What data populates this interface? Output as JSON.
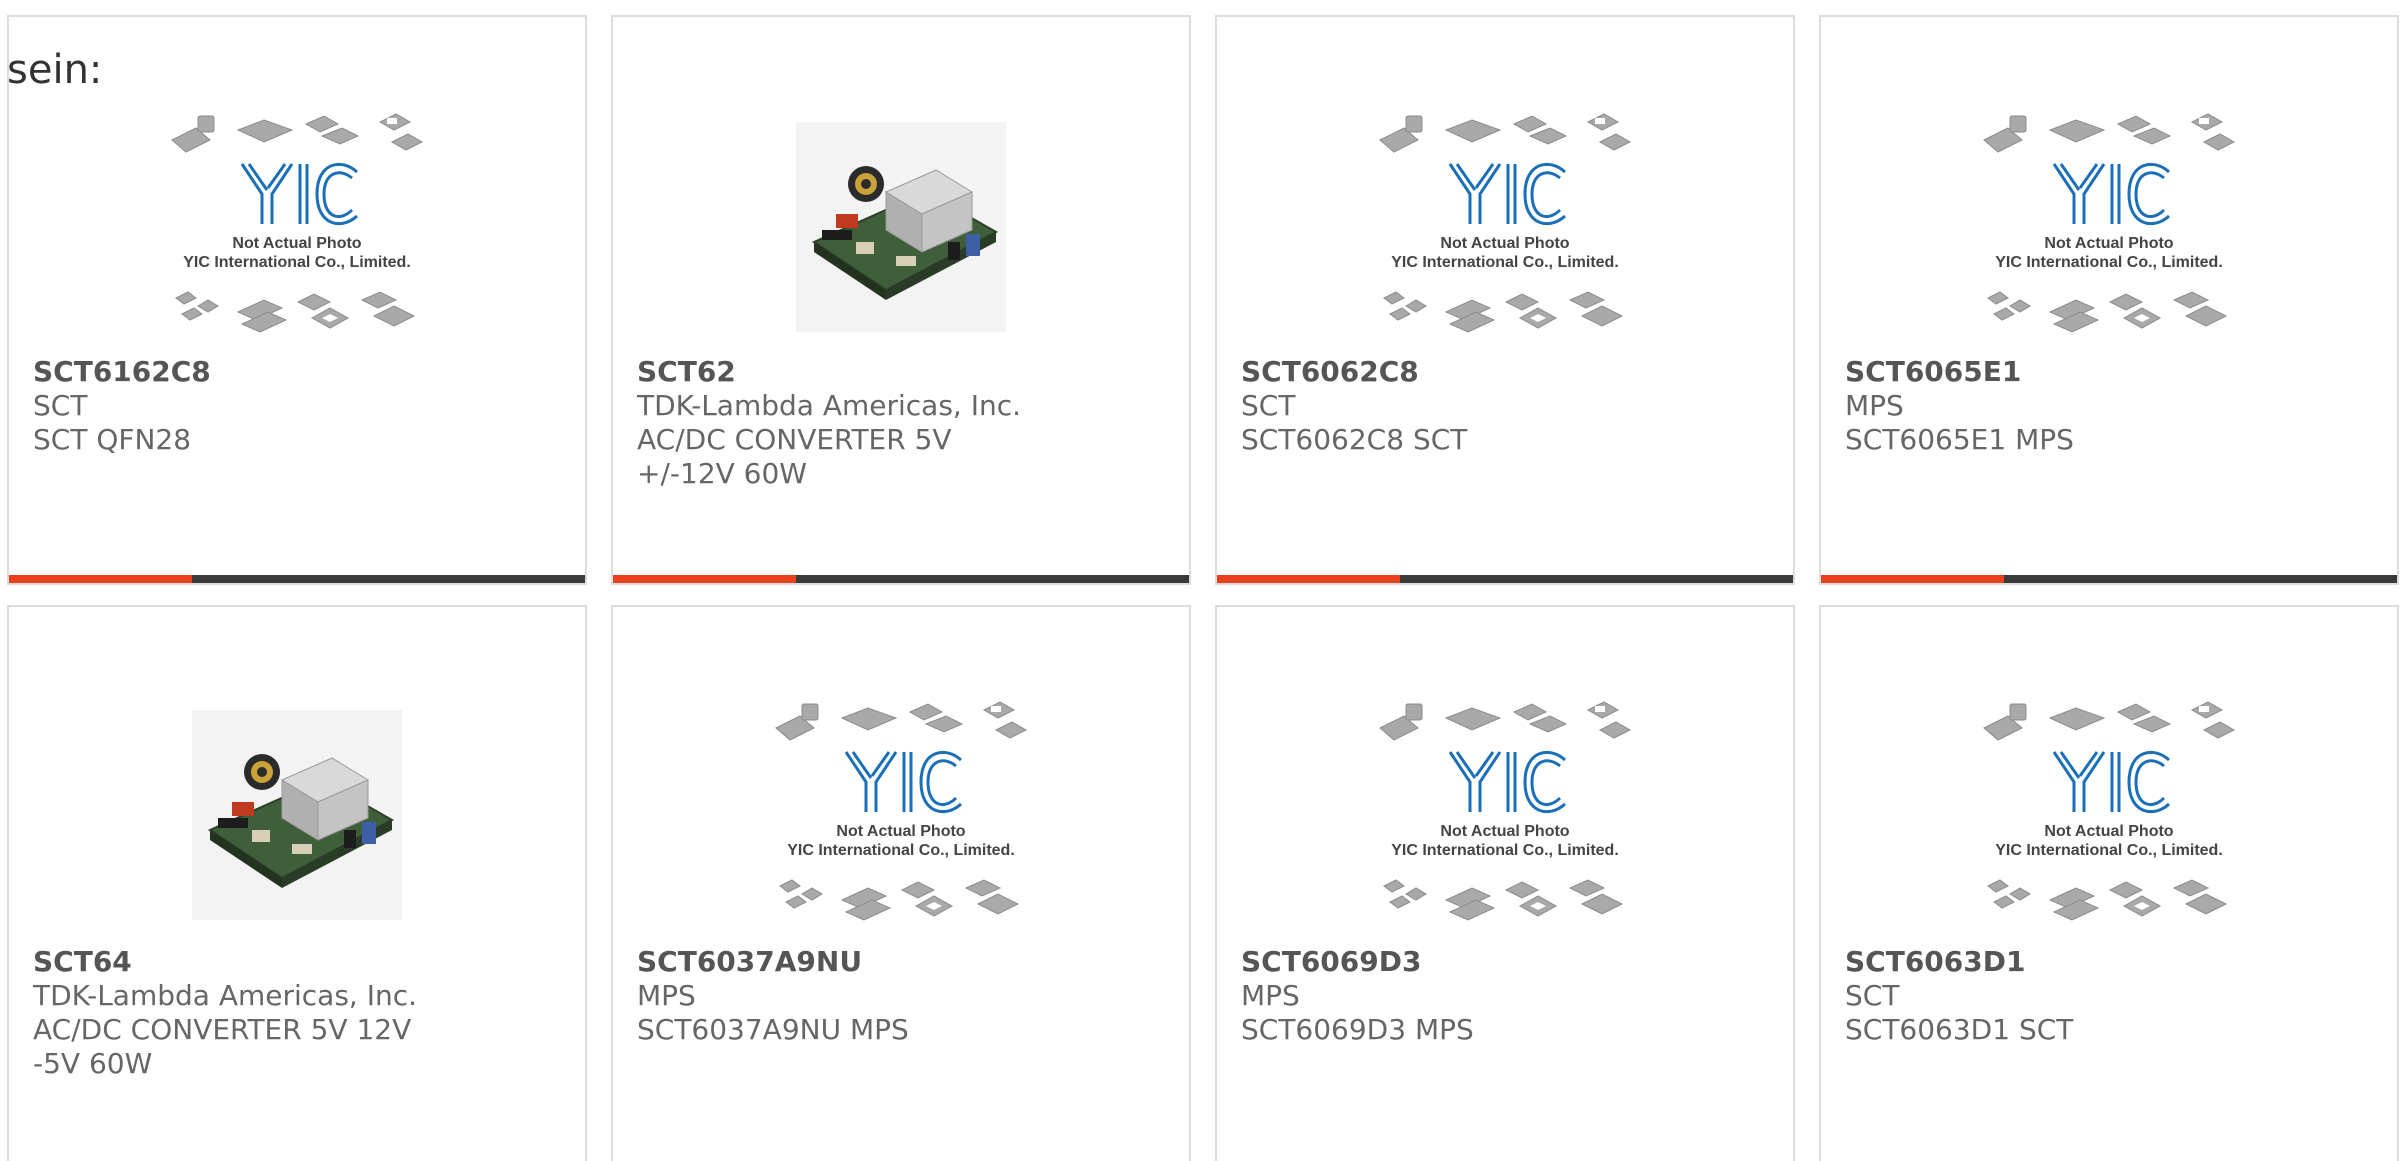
{
  "intro_text": "sein:",
  "colors": {
    "accent": "#e8401c",
    "bar": "#3a3a3a",
    "yic_blue": "#1a6fb8"
  },
  "placeholder": {
    "line1": "Not Actual Photo",
    "line2": "YIC International Co., Limited."
  },
  "products": [
    {
      "part": "SCT6162C8",
      "manufacturer": "SCT",
      "description": "SCT QFN28",
      "image": "placeholder-icon",
      "show_bar": true
    },
    {
      "part": "SCT62",
      "manufacturer": "TDK-Lambda Americas, Inc.",
      "description": "AC/DC CONVERTER 5V +/-12V 60W",
      "image": "power-supply-board-icon",
      "show_bar": true
    },
    {
      "part": "SCT6062C8",
      "manufacturer": "SCT",
      "description": "SCT6062C8 SCT",
      "image": "placeholder-icon",
      "show_bar": true
    },
    {
      "part": "SCT6065E1",
      "manufacturer": "MPS",
      "description": "SCT6065E1 MPS",
      "image": "placeholder-icon",
      "show_bar": true
    },
    {
      "part": "SCT64",
      "manufacturer": "TDK-Lambda Americas, Inc.",
      "description": "AC/DC CONVERTER 5V 12V -5V 60W",
      "image": "power-supply-board-icon",
      "show_bar": false
    },
    {
      "part": "SCT6037A9NU",
      "manufacturer": "MPS",
      "description": "SCT6037A9NU MPS",
      "image": "placeholder-icon",
      "show_bar": false
    },
    {
      "part": "SCT6069D3",
      "manufacturer": "MPS",
      "description": "SCT6069D3 MPS",
      "image": "placeholder-icon",
      "show_bar": false
    },
    {
      "part": "SCT6063D1",
      "manufacturer": "SCT",
      "description": "SCT6063D1 SCT",
      "image": "placeholder-icon",
      "show_bar": false
    }
  ]
}
